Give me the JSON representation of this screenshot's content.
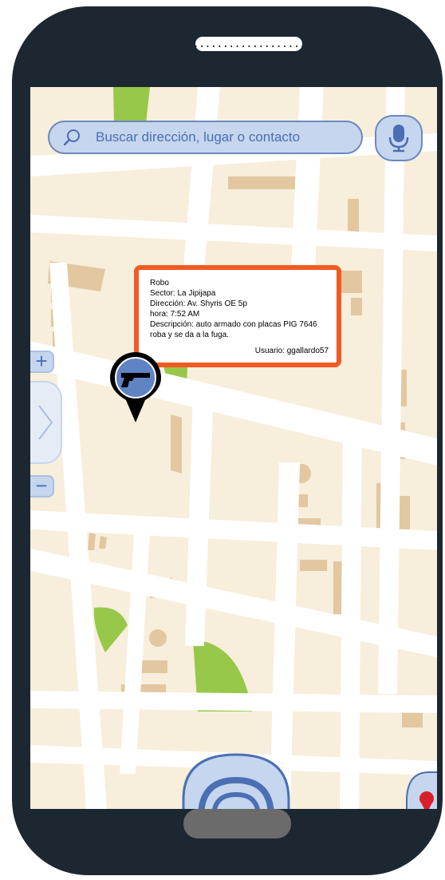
{
  "search": {
    "placeholder": "Buscar dirección, lugar o contacto"
  },
  "report": {
    "type": "Robo",
    "sector": "Sector:  La Jipijapa",
    "direccion": "Dirección: Av. Shyris OE 5p",
    "hora": "hora:  7:52 AM",
    "descripcion_1": "Descripción: auto armado con placas PIG 7646",
    "descripcion_2": "roba y se da a la fuga.",
    "usuario": "Usuario: ggallardo57"
  },
  "controls": {
    "zoom_in": "+",
    "zoom_out": "−"
  },
  "icons": {
    "search": "search-icon",
    "mic": "microphone-icon",
    "pin": "gun-marker-icon",
    "expand": "chevron-right-icon",
    "locate": "location-target-icon",
    "report": "map-pin-icon"
  },
  "colors": {
    "map_background": "#f7eedb",
    "road": "#ffffff",
    "building": "#e2c7a0",
    "park": "#98c84a",
    "ui_blue": "#c5d6ee",
    "ui_blue_border": "#6b88c0",
    "alert_orange": "#f05a23",
    "phone_body": "#1c2731"
  }
}
